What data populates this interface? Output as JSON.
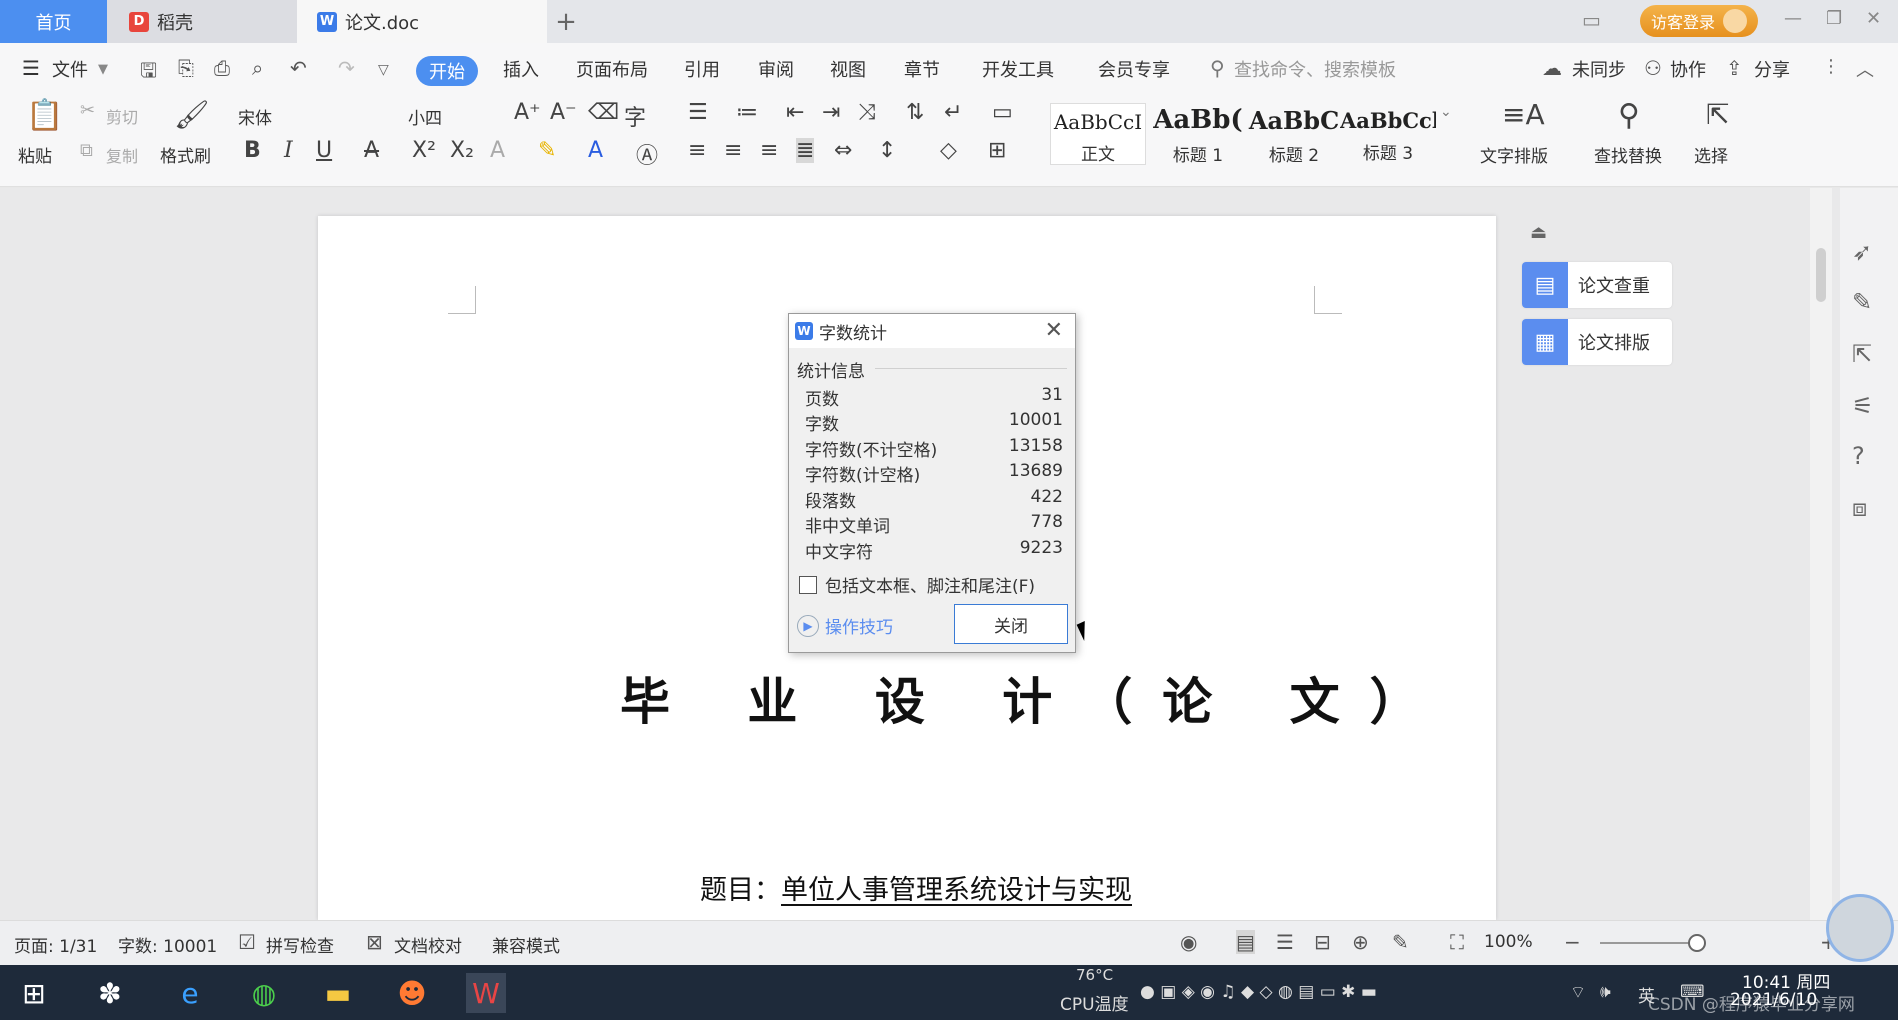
{
  "tabs": {
    "home": "首页",
    "daoke": "稻壳",
    "doc": "论文.doc",
    "add": "+"
  },
  "account": {
    "login": "访客登录"
  },
  "menu": {
    "file": "文件",
    "items": [
      "开始",
      "插入",
      "页面布局",
      "引用",
      "审阅",
      "视图",
      "章节",
      "开发工具",
      "会员专享"
    ],
    "search_placeholder": "查找命令、搜索模板",
    "sync": "未同步",
    "collab": "协作",
    "share": "分享"
  },
  "ribbon": {
    "paste": "粘贴",
    "cut": "剪切",
    "copy": "复制",
    "format_painter": "格式刷",
    "font_name": "宋体",
    "font_size": "小四",
    "styles": [
      {
        "sample": "AaBbCcI",
        "name": "正文"
      },
      {
        "sample": "AaBb(",
        "name": "标题 1"
      },
      {
        "sample": "AaBbC",
        "name": "标题 2"
      },
      {
        "sample": "AaBbCcl",
        "name": "标题 3"
      }
    ],
    "text_layout": "文字排版",
    "find_replace": "查找替换",
    "select": "选择"
  },
  "side_panel": {
    "check": "论文查重",
    "layout": "论文排版"
  },
  "document": {
    "title": "毕 业 设 计（论 文）",
    "subject_label": "题目：",
    "subject_value": "单位人事管理系统设计与实现"
  },
  "dialog": {
    "title": "字数统计",
    "section": "统计信息",
    "stats": [
      {
        "label": "页数",
        "value": "31"
      },
      {
        "label": "字数",
        "value": "10001"
      },
      {
        "label": "字符数(不计空格)",
        "value": "13158"
      },
      {
        "label": "字符数(计空格)",
        "value": "13689"
      },
      {
        "label": "段落数",
        "value": "422"
      },
      {
        "label": "非中文单词",
        "value": "778"
      },
      {
        "label": "中文字符",
        "value": "9223"
      }
    ],
    "include_label": "包括文本框、脚注和尾注(F)",
    "tips": "操作技巧",
    "close": "关闭"
  },
  "status": {
    "page": "页面: 1/31",
    "words": "字数: 10001",
    "spell": "拼写检查",
    "proof": "文档校对",
    "compat": "兼容模式",
    "zoom": "100%"
  },
  "taskbar": {
    "cpu_temp": "76°C",
    "cpu_label": "CPU温度",
    "ime": "英",
    "time": "10:41 周四",
    "date": "2021/6/10",
    "watermark": "CSDN @程序猿毕业分享网"
  }
}
